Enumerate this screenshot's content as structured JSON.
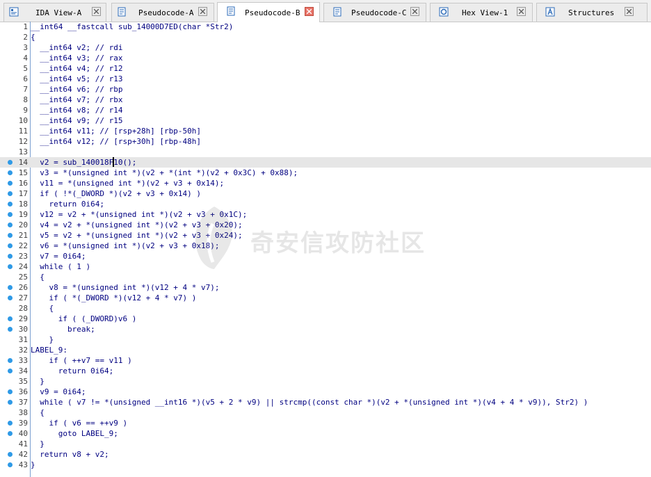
{
  "tabs": [
    {
      "label": "IDA View-A"
    },
    {
      "label": "Pseudocode-A"
    },
    {
      "label": "Pseudocode-B"
    },
    {
      "label": "Pseudocode-C"
    },
    {
      "label": "Hex View-1"
    },
    {
      "label": "Structures"
    }
  ],
  "watermark": {
    "text": "奇安信攻防社区"
  },
  "code": {
    "lines": [
      {
        "n": "1",
        "t": "__int64 __fastcall sub_14000D7ED(char *Str2)"
      },
      {
        "n": "2",
        "t": "{"
      },
      {
        "n": "3",
        "t": "  __int64 v2; // rdi"
      },
      {
        "n": "4",
        "t": "  __int64 v3; // rax"
      },
      {
        "n": "5",
        "t": "  __int64 v4; // r12"
      },
      {
        "n": "6",
        "t": "  __int64 v5; // r13"
      },
      {
        "n": "7",
        "t": "  __int64 v6; // rbp"
      },
      {
        "n": "8",
        "t": "  __int64 v7; // rbx"
      },
      {
        "n": "9",
        "t": "  __int64 v8; // r14"
      },
      {
        "n": "10",
        "t": "  __int64 v9; // r15"
      },
      {
        "n": "11",
        "t": "  __int64 v11; // [rsp+28h] [rbp-50h]"
      },
      {
        "n": "12",
        "t": "  __int64 v12; // [rsp+30h] [rbp-48h]"
      },
      {
        "n": "13",
        "t": ""
      },
      {
        "n": "14",
        "t": "  v2 = sub_140018F10();"
      },
      {
        "n": "15",
        "t": "  v3 = *(unsigned int *)(v2 + *(int *)(v2 + 0x3C) + 0x88);"
      },
      {
        "n": "16",
        "t": "  v11 = *(unsigned int *)(v2 + v3 + 0x14);"
      },
      {
        "n": "17",
        "t": "  if ( !*(_DWORD *)(v2 + v3 + 0x14) )"
      },
      {
        "n": "18",
        "t": "    return 0i64;"
      },
      {
        "n": "19",
        "t": "  v12 = v2 + *(unsigned int *)(v2 + v3 + 0x1C);"
      },
      {
        "n": "20",
        "t": "  v4 = v2 + *(unsigned int *)(v2 + v3 + 0x20);"
      },
      {
        "n": "21",
        "t": "  v5 = v2 + *(unsigned int *)(v2 + v3 + 0x24);"
      },
      {
        "n": "22",
        "t": "  v6 = *(unsigned int *)(v2 + v3 + 0x18);"
      },
      {
        "n": "23",
        "t": "  v7 = 0i64;"
      },
      {
        "n": "24",
        "t": "  while ( 1 )"
      },
      {
        "n": "25",
        "t": "  {"
      },
      {
        "n": "26",
        "t": "    v8 = *(unsigned int *)(v12 + 4 * v7);"
      },
      {
        "n": "27",
        "t": "    if ( *(_DWORD *)(v12 + 4 * v7) )"
      },
      {
        "n": "28",
        "t": "    {"
      },
      {
        "n": "29",
        "t": "      if ( (_DWORD)v6 )"
      },
      {
        "n": "30",
        "t": "        break;"
      },
      {
        "n": "31",
        "t": "    }"
      },
      {
        "n": "32",
        "t": "LABEL_9:"
      },
      {
        "n": "33",
        "t": "    if ( ++v7 == v11 )"
      },
      {
        "n": "34",
        "t": "      return 0i64;"
      },
      {
        "n": "35",
        "t": "  }"
      },
      {
        "n": "36",
        "t": "  v9 = 0i64;"
      },
      {
        "n": "37",
        "t": "  while ( v7 != *(unsigned __int16 *)(v5 + 2 * v9) || strcmp((const char *)(v2 + *(unsigned int *)(v4 + 4 * v9)), Str2) )"
      },
      {
        "n": "38",
        "t": "  {"
      },
      {
        "n": "39",
        "t": "    if ( v6 == ++v9 )"
      },
      {
        "n": "40",
        "t": "      goto LABEL_9;"
      },
      {
        "n": "41",
        "t": "  }"
      },
      {
        "n": "42",
        "t": "  return v8 + v2;"
      },
      {
        "n": "43",
        "t": "}"
      }
    ]
  }
}
